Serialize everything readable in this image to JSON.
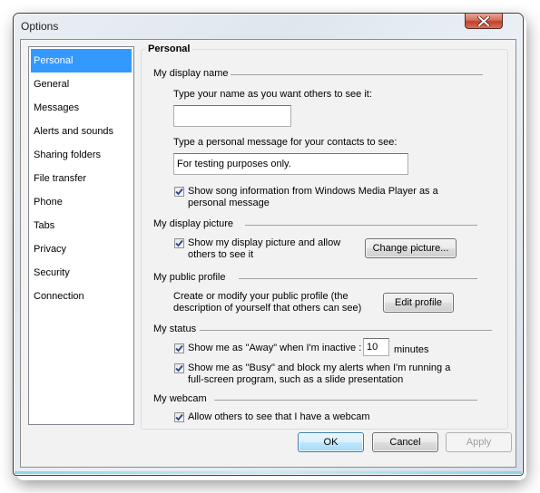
{
  "window": {
    "title": "Options",
    "close_icon": "close-x-icon"
  },
  "nav": {
    "items": [
      {
        "label": "Personal",
        "selected": true
      },
      {
        "label": "General",
        "selected": false
      },
      {
        "label": "Messages",
        "selected": false
      },
      {
        "label": "Alerts and sounds",
        "selected": false
      },
      {
        "label": "Sharing folders",
        "selected": false
      },
      {
        "label": "File transfer",
        "selected": false
      },
      {
        "label": "Phone",
        "selected": false
      },
      {
        "label": "Tabs",
        "selected": false
      },
      {
        "label": "Privacy",
        "selected": false
      },
      {
        "label": "Security",
        "selected": false
      },
      {
        "label": "Connection",
        "selected": false
      }
    ]
  },
  "panel": {
    "title": "Personal",
    "display_name": {
      "group_label": "My display name",
      "name_prompt": "Type your name as you want others to see it:",
      "name_value": "",
      "message_prompt": "Type a personal message for your contacts to see:",
      "message_value": "For testing purposes only.",
      "show_song_label": "Show song information from Windows Media Player as a personal message",
      "show_song_checked": true
    },
    "display_picture": {
      "group_label": "My display picture",
      "show_picture_label": "Show my display picture and allow others to see it",
      "show_picture_checked": true,
      "change_button": "Change picture..."
    },
    "public_profile": {
      "group_label": "My public profile",
      "description": "Create or modify your public profile (the description of yourself that others can see)",
      "edit_button": "Edit profile"
    },
    "status": {
      "group_label": "My status",
      "away_label": "Show me as \"Away\" when I'm inactive :",
      "away_checked": true,
      "away_minutes": "10",
      "minutes_label": "minutes",
      "busy_label": "Show me as \"Busy\" and block my alerts when I'm running a full-screen program, such as a slide presentation",
      "busy_checked": true
    },
    "webcam": {
      "group_label": "My  webcam",
      "allow_label": "Allow others to see that I have a webcam",
      "allow_checked": true
    }
  },
  "footer": {
    "ok": "OK",
    "cancel": "Cancel",
    "apply": "Apply",
    "apply_enabled": false
  }
}
